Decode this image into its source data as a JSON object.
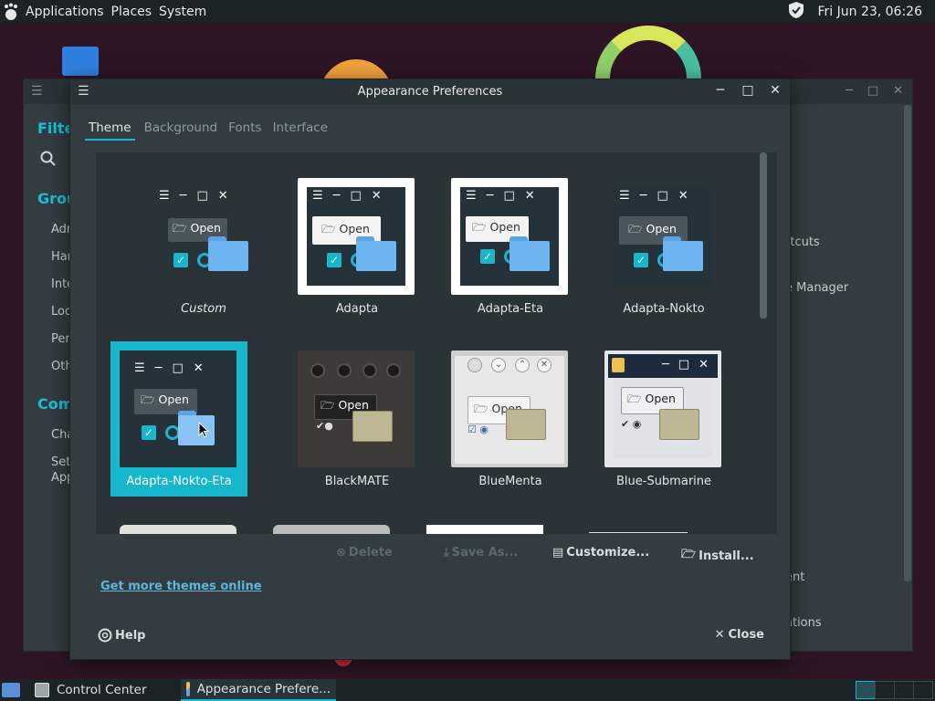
{
  "top_panel": {
    "menus": [
      "Applications",
      "Places",
      "System"
    ],
    "clock": "Fri Jun 23, 06:26",
    "icons": [
      "gnome-foot-icon",
      "shield-icon"
    ]
  },
  "control_center": {
    "headings": [
      "Filter",
      "Groups",
      "Common Tasks"
    ],
    "sidebar_items": [
      "Administration",
      "Hardware",
      "Internet",
      "Look and Feel",
      "Personal",
      "Other",
      "Change Theme",
      "Set Preferred Applications"
    ],
    "visible_sidebar_items": [
      "Adm",
      "Har",
      "Inte",
      "Loo",
      "Per",
      "Oth",
      "Cha",
      "Set",
      "App"
    ],
    "visible_headings": [
      "Filte",
      "Grou",
      "Comm"
    ],
    "right_items": [
      "rtcuts",
      "e Manager",
      "ent",
      "ations"
    ]
  },
  "dialog": {
    "title": "Appearance Preferences",
    "tabs": [
      "Theme",
      "Background",
      "Fonts",
      "Interface"
    ],
    "active_tab": "Theme",
    "preview_open_label": "Open",
    "themes": [
      {
        "name": "Custom",
        "style": "adapta-nokto"
      },
      {
        "name": "Adapta",
        "style": "adapta"
      },
      {
        "name": "Adapta-Eta",
        "style": "adapta"
      },
      {
        "name": "Adapta-Nokto",
        "style": "adapta-nokto"
      },
      {
        "name": "Adapta-Nokto-Eta",
        "style": "adapta-nokto",
        "selected": true
      },
      {
        "name": "BlackMATE",
        "style": "blackmate"
      },
      {
        "name": "BlueMenta",
        "style": "bluementa"
      },
      {
        "name": "Blue-Submarine",
        "style": "blue-submarine"
      }
    ],
    "actions": {
      "delete": "Delete",
      "save_as": "Save As...",
      "customize": "Customize...",
      "install": "Install..."
    },
    "more_link": "Get more themes online",
    "help": "Help",
    "close": "Close"
  },
  "taskbar": {
    "tasks": [
      "Control Center",
      "Appearance Prefere..."
    ],
    "active_task": "Appearance Prefere...",
    "workspaces": 4
  },
  "colors": {
    "accent": "#16b7cc",
    "panel": "#1b2327",
    "window": "#323c41"
  }
}
